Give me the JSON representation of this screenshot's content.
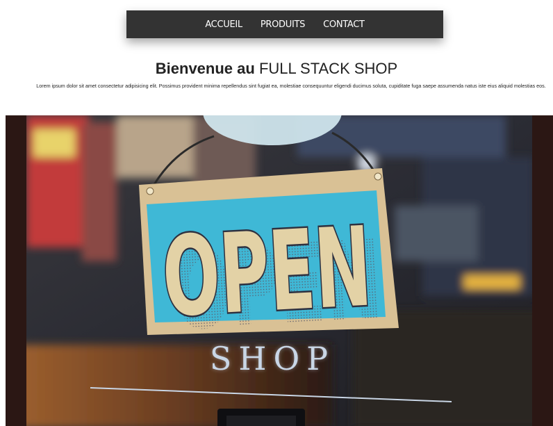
{
  "nav": {
    "items": [
      {
        "label": "ACCUEIL"
      },
      {
        "label": "PRODUITS"
      },
      {
        "label": "CONTACT"
      }
    ]
  },
  "header": {
    "title_bold": "Bienvenue au",
    "title_rest": "FULL STACK SHOP",
    "intro": "Lorem ipsum dolor sit amet consectetur adipisicing elit. Possimus provident minima repellendus sint fugiat ea, molestiae consequuntur eligendi ducimus soluta, cupiditate fuga saepe assumenda natus iste eius aliquid molestias eos."
  },
  "hero": {
    "sign_text": "OPEN",
    "window_text": "SHOP",
    "colors": {
      "sign_blue": "#3fb8d6",
      "sign_board": "#d9c195",
      "letter_cream": "#e3d2a6",
      "letter_shadow": "#2e3140",
      "window_text": "#c9d6e6"
    }
  }
}
